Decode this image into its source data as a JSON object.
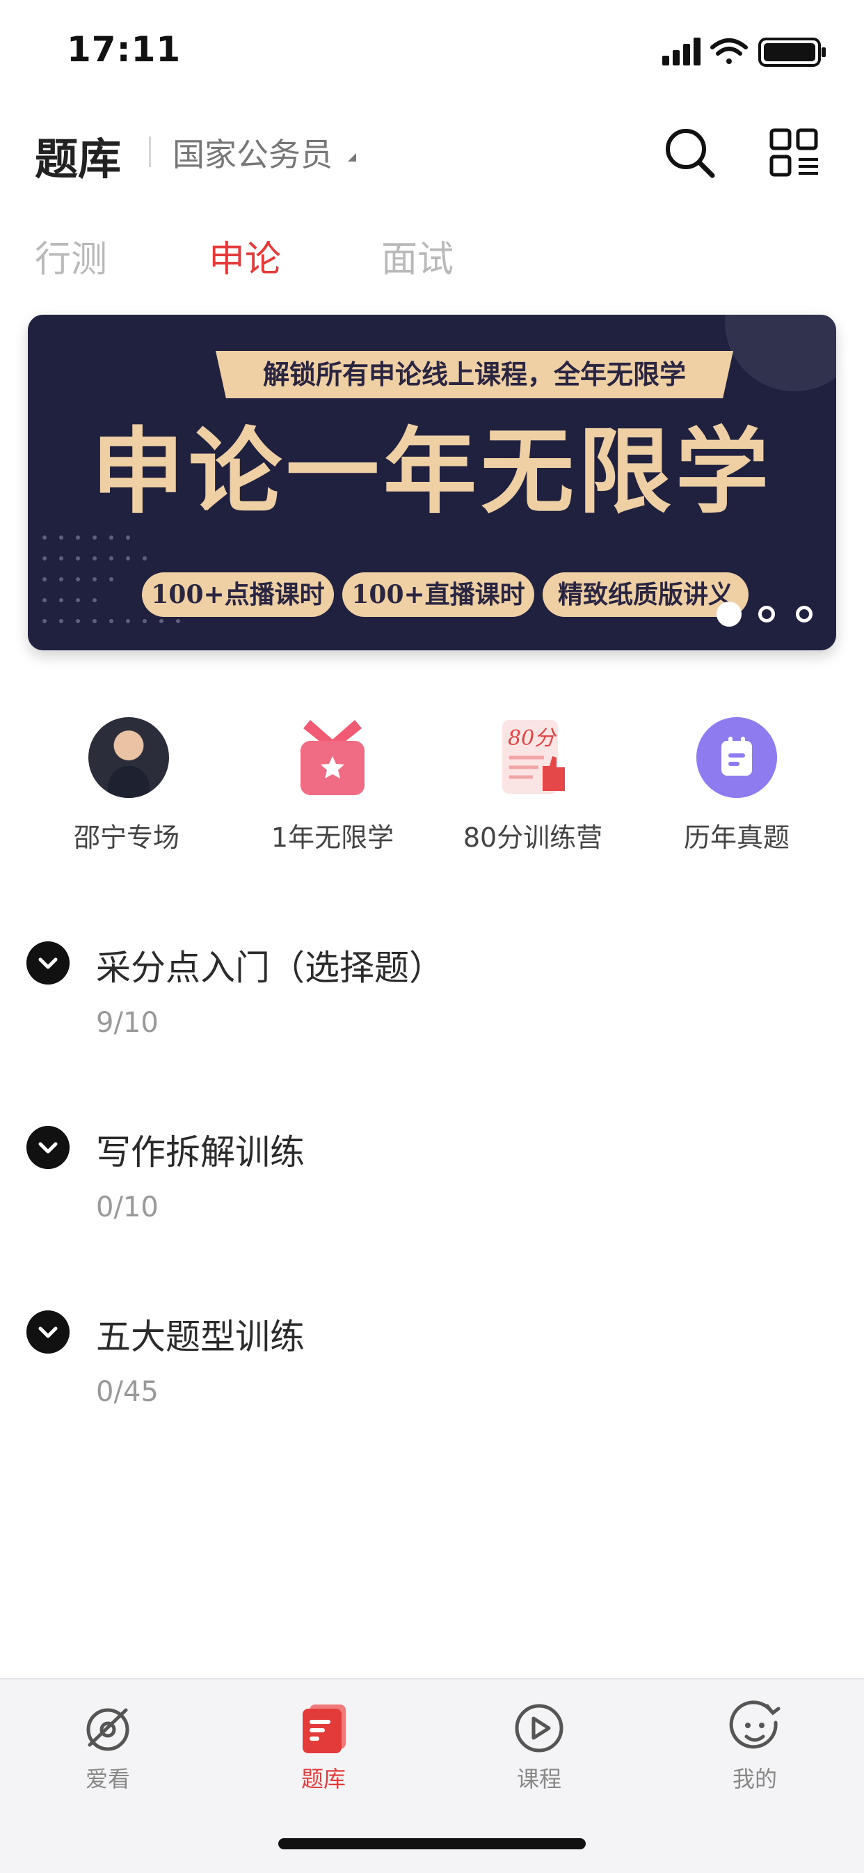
{
  "status_bar": {
    "time": "17:11"
  },
  "header": {
    "title": "题库",
    "category": "国家公务员"
  },
  "tabs": [
    {
      "label": "行测",
      "active": false
    },
    {
      "label": "申论",
      "active": true
    },
    {
      "label": "面试",
      "active": false
    }
  ],
  "banner": {
    "top_text": "解锁所有申论线上课程，全年无限学",
    "main_text": "申论一年无限学",
    "pills": [
      "100+点播课时",
      "100+直播课时",
      "精致纸质版讲义"
    ],
    "page_count": 3,
    "active_page": 1
  },
  "quick_entries": [
    {
      "label": "邵宁专场",
      "icon": "teacher-avatar"
    },
    {
      "label": "1年无限学",
      "icon": "ribbon-star-icon"
    },
    {
      "label": "80分训练营",
      "icon": "score-80-icon"
    },
    {
      "label": "历年真题",
      "icon": "past-papers-icon"
    }
  ],
  "sections": [
    {
      "title": "采分点入门（选择题）",
      "progress": "9/10"
    },
    {
      "title": "写作拆解训练",
      "progress": "0/10"
    },
    {
      "title": "五大题型训练",
      "progress": "0/45"
    }
  ],
  "bottom_nav": [
    {
      "label": "爱看",
      "icon": "compass-icon",
      "active": false
    },
    {
      "label": "题库",
      "icon": "question-bank-icon",
      "active": true
    },
    {
      "label": "课程",
      "icon": "play-icon",
      "active": false
    },
    {
      "label": "我的",
      "icon": "smile-icon",
      "active": false
    }
  ],
  "colors": {
    "accent": "#e33a3a",
    "banner_bg": "#20213e",
    "banner_gold": "#efcfa4"
  }
}
